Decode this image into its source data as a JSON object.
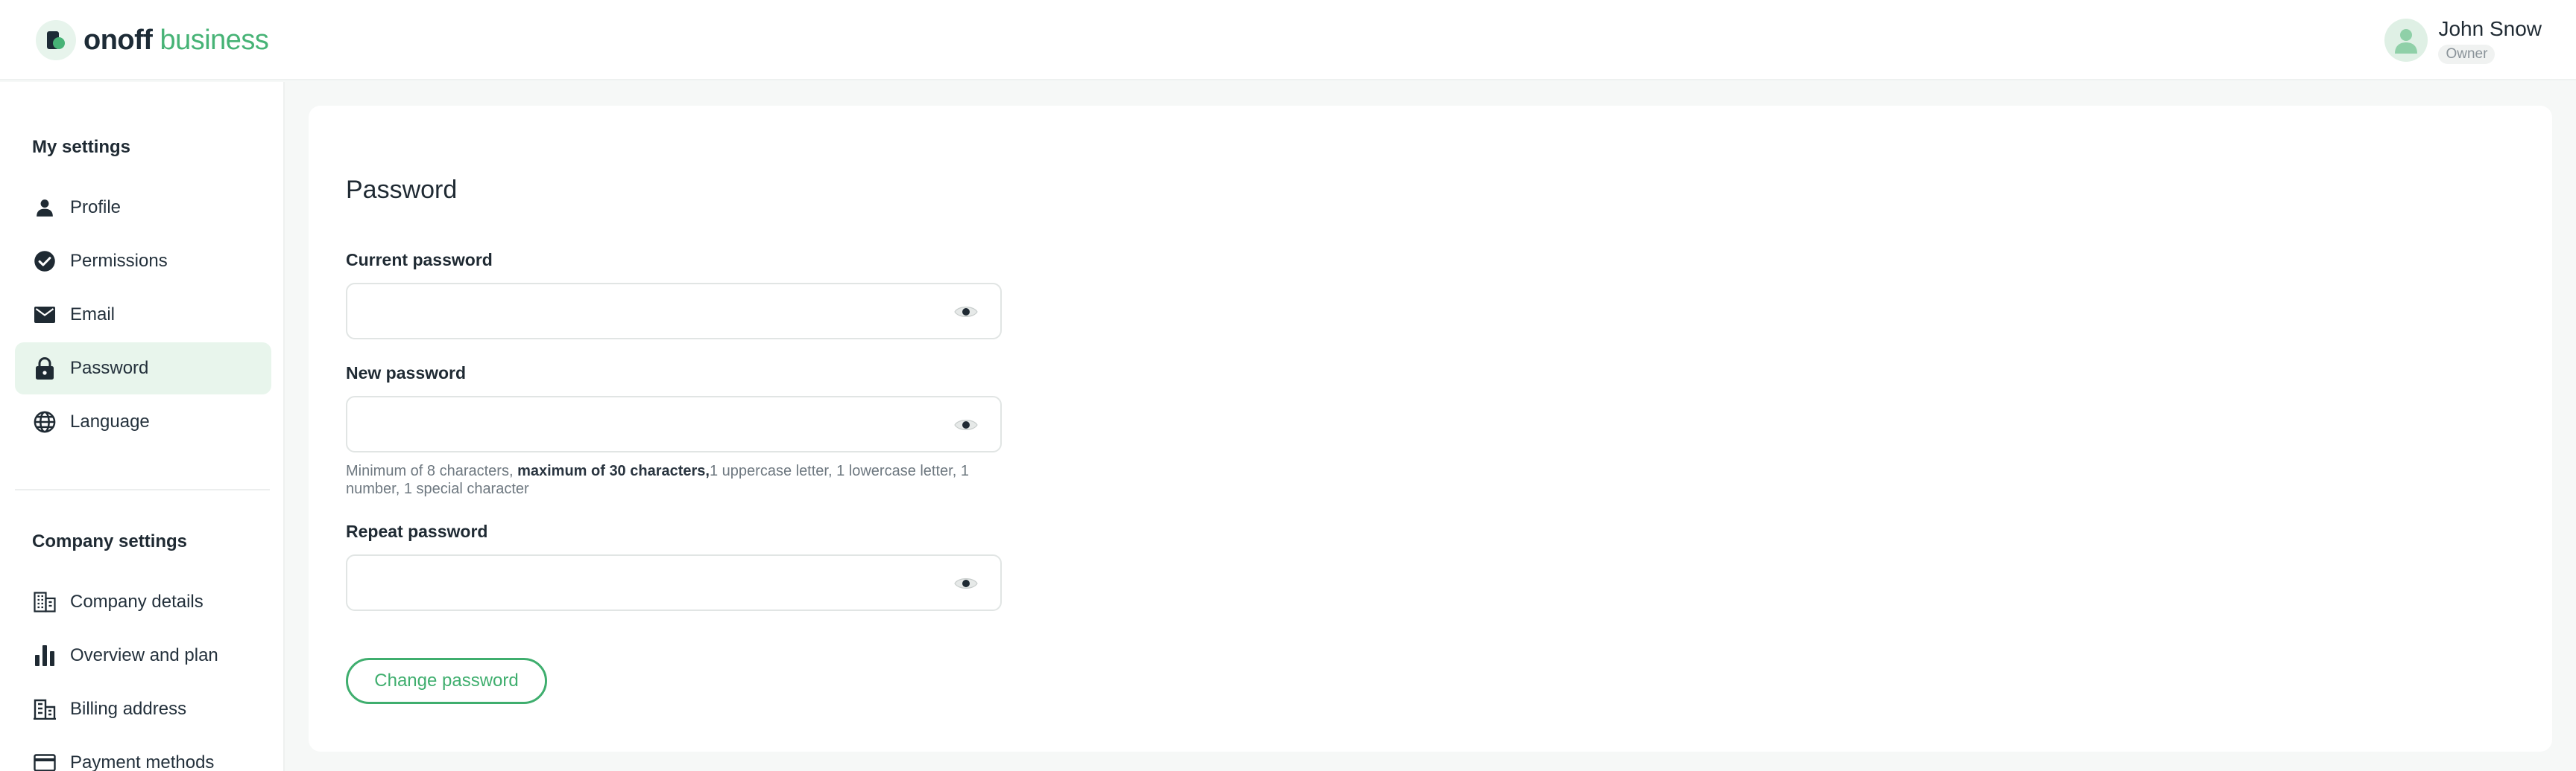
{
  "brand": {
    "name_bold": "onoff",
    "name_light": "business",
    "accent": "#47b376"
  },
  "user": {
    "name": "John Snow",
    "role": "Owner"
  },
  "sidebar": {
    "my_settings_title": "My settings",
    "my_settings_items": [
      {
        "label": "Profile",
        "icon": "person-icon"
      },
      {
        "label": "Permissions",
        "icon": "check-circle-icon"
      },
      {
        "label": "Email",
        "icon": "envelope-icon"
      },
      {
        "label": "Password",
        "icon": "lock-icon",
        "active": true
      },
      {
        "label": "Language",
        "icon": "globe-icon"
      }
    ],
    "company_settings_title": "Company settings",
    "company_settings_items": [
      {
        "label": "Company details",
        "icon": "building-icon"
      },
      {
        "label": "Overview and plan",
        "icon": "bar-chart-icon"
      },
      {
        "label": "Billing address",
        "icon": "billing-building-icon"
      },
      {
        "label": "Payment methods",
        "icon": "credit-card-icon"
      }
    ]
  },
  "main": {
    "title": "Password",
    "fields": [
      {
        "label": "Current password",
        "value": ""
      },
      {
        "label": "New password",
        "value": ""
      },
      {
        "label": "Repeat password",
        "value": ""
      }
    ],
    "hint_part1": "Minimum of 8 characters, ",
    "hint_bold": "maximum of 30 characters,",
    "hint_part2": "1 uppercase letter, 1 lowercase letter, 1 number, 1 special character",
    "submit_label": "Change password"
  }
}
